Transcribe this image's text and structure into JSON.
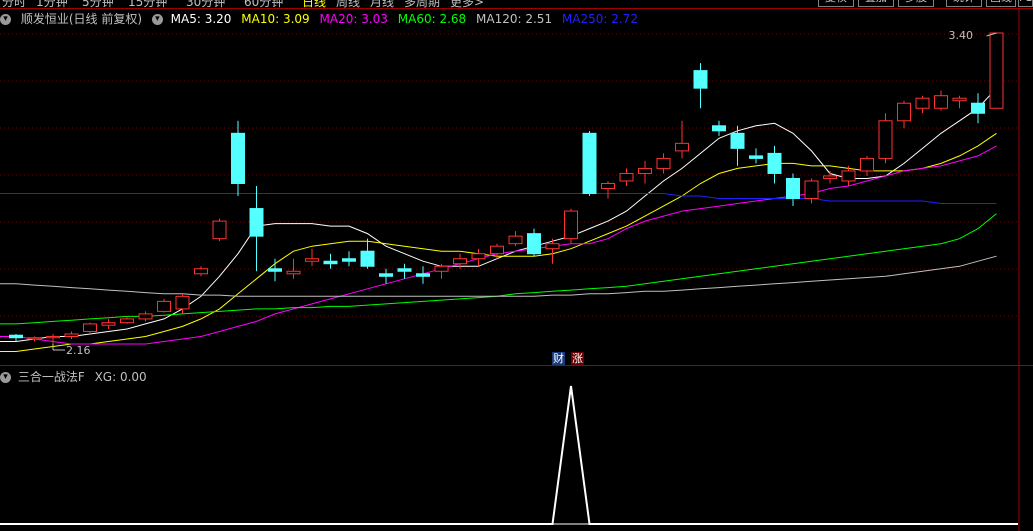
{
  "topbar": {
    "periods": [
      "分时",
      "1分钟",
      "5分钟",
      "15分钟",
      "30分钟",
      "60分钟",
      "日线",
      "周线",
      "月线",
      "多周期",
      "更多>"
    ],
    "active_period": "日线",
    "buttons": [
      "复权",
      "叠加",
      "多股",
      "统计",
      "画线",
      "F10"
    ]
  },
  "legend": {
    "stock_name": "顺发恒业(日线 前复权)",
    "ma": [
      {
        "label": "MA5: 3.20",
        "color": "#ffffff"
      },
      {
        "label": "MA10: 3.09",
        "color": "#ffff00"
      },
      {
        "label": "MA20: 3.03",
        "color": "#ff00ff"
      },
      {
        "label": "MA60: 2.68",
        "color": "#00ff00"
      },
      {
        "label": "MA120: 2.51",
        "color": "#c0c0c0"
      },
      {
        "label": "MA250: 2.72",
        "color": "#2020ff"
      }
    ]
  },
  "indicator": {
    "name": "三合一战法F",
    "value_label": "XG: 0.00"
  },
  "badges": {
    "cai": "财",
    "zhang": "涨"
  },
  "chart_data": [
    {
      "type": "candlestick",
      "title": "顺发恒业(日线 前复权)",
      "max_label": "3.40",
      "min_label": "2.16",
      "up_color": "#ff3232",
      "down_color": "#54ffff",
      "candles": [
        [
          2.195,
          2.2,
          2.17,
          2.185
        ],
        [
          2.18,
          2.19,
          2.17,
          2.185
        ],
        [
          2.185,
          2.2,
          2.16,
          2.19
        ],
        [
          2.19,
          2.21,
          2.18,
          2.2
        ],
        [
          2.21,
          2.245,
          2.2,
          2.24
        ],
        [
          2.235,
          2.26,
          2.22,
          2.245
        ],
        [
          2.245,
          2.27,
          2.24,
          2.26
        ],
        [
          2.26,
          2.29,
          2.25,
          2.28
        ],
        [
          2.29,
          2.34,
          2.285,
          2.33
        ],
        [
          2.3,
          2.36,
          2.28,
          2.35
        ],
        [
          2.44,
          2.47,
          2.43,
          2.46
        ],
        [
          2.58,
          2.66,
          2.57,
          2.65
        ],
        [
          3.0,
          3.05,
          2.75,
          2.8
        ],
        [
          2.7,
          2.79,
          2.45,
          2.59
        ],
        [
          2.46,
          2.5,
          2.41,
          2.45
        ],
        [
          2.44,
          2.5,
          2.42,
          2.45
        ],
        [
          2.49,
          2.54,
          2.47,
          2.5
        ],
        [
          2.49,
          2.52,
          2.46,
          2.48
        ],
        [
          2.5,
          2.53,
          2.47,
          2.49
        ],
        [
          2.53,
          2.58,
          2.46,
          2.47
        ],
        [
          2.44,
          2.46,
          2.4,
          2.43
        ],
        [
          2.46,
          2.48,
          2.42,
          2.45
        ],
        [
          2.44,
          2.47,
          2.4,
          2.43
        ],
        [
          2.45,
          2.48,
          2.42,
          2.47
        ],
        [
          2.48,
          2.52,
          2.46,
          2.5
        ],
        [
          2.5,
          2.54,
          2.47,
          2.52
        ],
        [
          2.52,
          2.56,
          2.5,
          2.55
        ],
        [
          2.56,
          2.61,
          2.55,
          2.59
        ],
        [
          2.6,
          2.62,
          2.51,
          2.52
        ],
        [
          2.54,
          2.58,
          2.48,
          2.56
        ],
        [
          2.58,
          2.7,
          2.56,
          2.69
        ],
        [
          3.0,
          3.01,
          2.75,
          2.76
        ],
        [
          2.78,
          2.81,
          2.74,
          2.8
        ],
        [
          2.81,
          2.86,
          2.79,
          2.84
        ],
        [
          2.84,
          2.89,
          2.8,
          2.86
        ],
        [
          2.86,
          2.92,
          2.84,
          2.9
        ],
        [
          2.93,
          3.05,
          2.9,
          2.96
        ],
        [
          3.25,
          3.28,
          3.1,
          3.18
        ],
        [
          3.03,
          3.05,
          2.99,
          3.01
        ],
        [
          3.0,
          3.03,
          2.87,
          2.94
        ],
        [
          2.91,
          2.94,
          2.88,
          2.9
        ],
        [
          2.92,
          2.95,
          2.8,
          2.84
        ],
        [
          2.82,
          2.84,
          2.71,
          2.74
        ],
        [
          2.74,
          2.82,
          2.72,
          2.81
        ],
        [
          2.82,
          2.85,
          2.8,
          2.83
        ],
        [
          2.81,
          2.87,
          2.79,
          2.85
        ],
        [
          2.85,
          2.91,
          2.83,
          2.9
        ],
        [
          2.9,
          3.08,
          2.88,
          3.05
        ],
        [
          3.05,
          3.13,
          3.02,
          3.12
        ],
        [
          3.1,
          3.15,
          3.08,
          3.14
        ],
        [
          3.1,
          3.17,
          3.09,
          3.15
        ],
        [
          3.13,
          3.15,
          3.1,
          3.14
        ],
        [
          3.12,
          3.16,
          3.04,
          3.08
        ],
        [
          3.1,
          3.4,
          3.1,
          3.4
        ]
      ],
      "ma_lines": [
        {
          "name": "MA5",
          "color": "#ffffff",
          "values": [
            2.17,
            2.18,
            2.19,
            2.19,
            2.2,
            2.21,
            2.22,
            2.24,
            2.26,
            2.3,
            2.35,
            2.43,
            2.52,
            2.63,
            2.64,
            2.64,
            2.64,
            2.63,
            2.63,
            2.6,
            2.55,
            2.52,
            2.49,
            2.47,
            2.47,
            2.47,
            2.5,
            2.53,
            2.55,
            2.57,
            2.59,
            2.62,
            2.65,
            2.69,
            2.75,
            2.81,
            2.86,
            2.92,
            2.98,
            3.01,
            3.03,
            3.04,
            3.0,
            2.93,
            2.84,
            2.82,
            2.82,
            2.83,
            2.88,
            2.94,
            3.0,
            3.05,
            3.1,
            3.18
          ]
        },
        {
          "name": "MA10",
          "color": "#ffff00",
          "values": [
            2.13,
            2.14,
            2.15,
            2.16,
            2.16,
            2.17,
            2.18,
            2.19,
            2.21,
            2.23,
            2.26,
            2.3,
            2.36,
            2.42,
            2.48,
            2.53,
            2.55,
            2.56,
            2.57,
            2.57,
            2.56,
            2.55,
            2.54,
            2.53,
            2.53,
            2.52,
            2.51,
            2.51,
            2.51,
            2.52,
            2.54,
            2.57,
            2.6,
            2.63,
            2.67,
            2.71,
            2.75,
            2.8,
            2.84,
            2.86,
            2.87,
            2.88,
            2.88,
            2.87,
            2.87,
            2.86,
            2.85,
            2.85,
            2.85,
            2.86,
            2.88,
            2.91,
            2.95,
            3.0
          ]
        },
        {
          "name": "MA20",
          "color": "#ff00ff",
          "values": [
            2.19,
            2.18,
            2.17,
            2.16,
            2.16,
            2.16,
            2.16,
            2.16,
            2.17,
            2.18,
            2.19,
            2.21,
            2.23,
            2.25,
            2.28,
            2.3,
            2.32,
            2.34,
            2.36,
            2.38,
            2.4,
            2.42,
            2.44,
            2.46,
            2.48,
            2.5,
            2.52,
            2.53,
            2.54,
            2.55,
            2.56,
            2.56,
            2.58,
            2.62,
            2.65,
            2.67,
            2.69,
            2.7,
            2.71,
            2.72,
            2.73,
            2.74,
            2.75,
            2.76,
            2.78,
            2.79,
            2.81,
            2.83,
            2.85,
            2.86,
            2.87,
            2.89,
            2.91,
            2.95
          ]
        },
        {
          "name": "MA60",
          "color": "#00ff00",
          "values": [
            2.24,
            2.245,
            2.25,
            2.255,
            2.26,
            2.265,
            2.27,
            2.27,
            2.275,
            2.28,
            2.285,
            2.29,
            2.295,
            2.3,
            2.3,
            2.305,
            2.305,
            2.31,
            2.31,
            2.315,
            2.32,
            2.325,
            2.33,
            2.335,
            2.34,
            2.345,
            2.35,
            2.36,
            2.365,
            2.37,
            2.375,
            2.38,
            2.385,
            2.39,
            2.4,
            2.41,
            2.42,
            2.43,
            2.44,
            2.45,
            2.46,
            2.47,
            2.48,
            2.49,
            2.5,
            2.51,
            2.52,
            2.53,
            2.54,
            2.55,
            2.56,
            2.58,
            2.62,
            2.68
          ]
        },
        {
          "name": "MA120",
          "color": "#c0c0c0",
          "values": [
            2.4,
            2.395,
            2.39,
            2.385,
            2.38,
            2.375,
            2.37,
            2.365,
            2.36,
            2.36,
            2.355,
            2.355,
            2.35,
            2.35,
            2.35,
            2.35,
            2.35,
            2.35,
            2.35,
            2.35,
            2.35,
            2.35,
            2.35,
            2.35,
            2.35,
            2.35,
            2.35,
            2.35,
            2.35,
            2.355,
            2.355,
            2.36,
            2.36,
            2.365,
            2.37,
            2.37,
            2.375,
            2.38,
            2.385,
            2.39,
            2.395,
            2.4,
            2.405,
            2.41,
            2.415,
            2.42,
            2.425,
            2.43,
            2.44,
            2.45,
            2.46,
            2.47,
            2.49,
            2.51
          ]
        },
        {
          "name": "MA250",
          "color": "#2020ff",
          "values": [
            2.76,
            2.76,
            2.76,
            2.76,
            2.76,
            2.76,
            2.76,
            2.76,
            2.76,
            2.76,
            2.76,
            2.76,
            2.76,
            2.76,
            2.76,
            2.76,
            2.76,
            2.76,
            2.76,
            2.76,
            2.76,
            2.76,
            2.76,
            2.76,
            2.76,
            2.76,
            2.76,
            2.76,
            2.76,
            2.76,
            2.76,
            2.76,
            2.76,
            2.76,
            2.76,
            2.76,
            2.75,
            2.75,
            2.74,
            2.74,
            2.74,
            2.74,
            2.74,
            2.74,
            2.73,
            2.73,
            2.73,
            2.73,
            2.73,
            2.73,
            2.72,
            2.72,
            2.72,
            2.72
          ]
        }
      ]
    },
    {
      "type": "line",
      "title": "三合一战法F",
      "series": [
        {
          "name": "XG",
          "color": "#ffffff",
          "values": [
            0,
            0,
            0,
            0,
            0,
            0,
            0,
            0,
            0,
            0,
            0,
            0,
            0,
            0,
            0,
            0,
            0,
            0,
            0,
            0,
            0,
            0,
            0,
            0,
            0,
            0,
            0,
            0,
            0,
            0,
            0,
            0,
            0,
            0,
            0,
            0,
            0,
            0,
            0,
            0,
            0,
            0,
            0,
            0,
            0,
            0,
            0,
            0,
            0,
            0,
            0,
            0,
            0,
            0
          ]
        },
        {
          "name": "signal",
          "color": "#ffffff",
          "values": [
            0,
            0,
            0,
            0,
            0,
            0,
            0,
            0,
            0,
            0,
            0,
            0,
            0,
            0,
            0,
            0,
            0,
            0,
            0,
            0,
            0,
            0,
            0,
            0,
            0,
            0,
            0,
            0,
            0,
            0,
            1,
            0,
            0,
            0,
            0,
            0,
            0,
            0,
            0,
            0,
            0,
            0,
            0,
            0,
            0,
            0,
            0,
            0,
            0,
            0,
            0,
            0,
            0,
            0
          ]
        }
      ],
      "ylim": [
        0,
        1
      ]
    }
  ]
}
